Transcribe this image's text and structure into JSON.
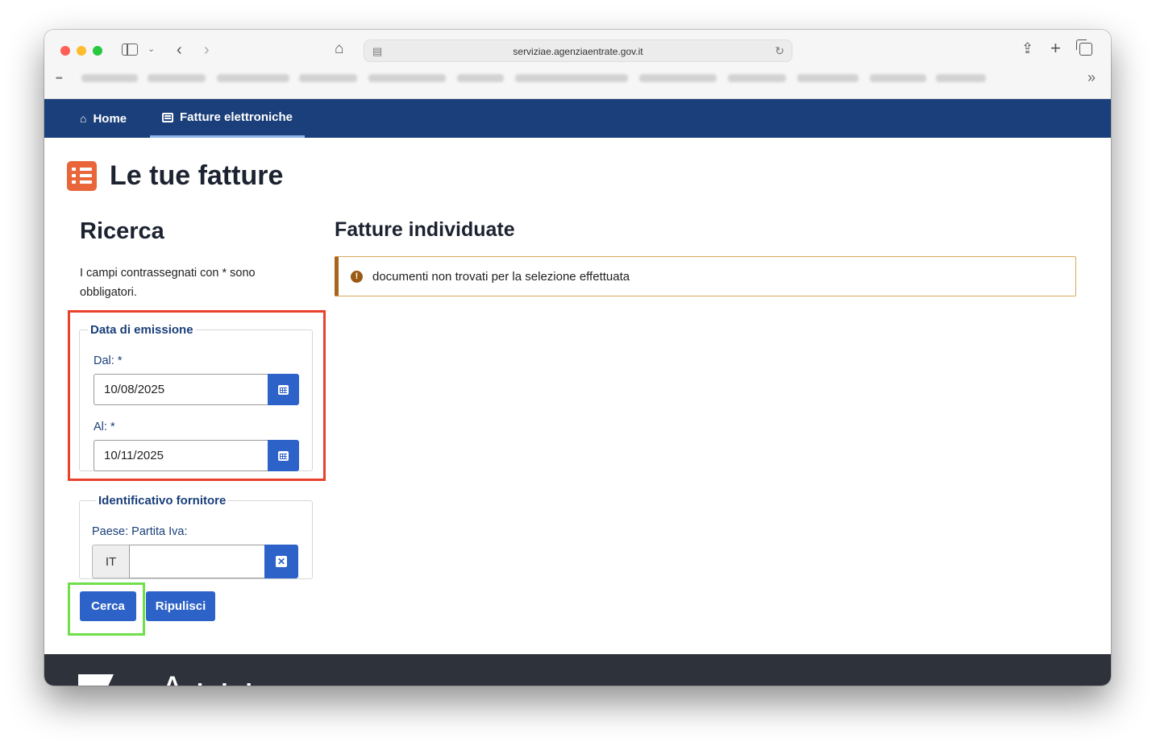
{
  "browser": {
    "url": "serviziae.agenziaentrate.gov.it"
  },
  "nav": {
    "home_label": "Home",
    "fatture_label": "Fatture elettroniche"
  },
  "page": {
    "title": "Le tue fatture"
  },
  "search": {
    "heading": "Ricerca",
    "required_note": "I campi contrassegnati con * sono obbligatori.",
    "date_group": {
      "legend": "Data di emissione",
      "from_label": "Dal: *",
      "from_value": "10/08/2025",
      "to_label": "Al: *",
      "to_value": "10/11/2025"
    },
    "supplier_group": {
      "legend": "Identificativo fornitore",
      "label": "Paese: Partita Iva:",
      "country": "IT",
      "vat_value": ""
    },
    "search_button": "Cerca",
    "reset_button": "Ripulisci"
  },
  "results": {
    "heading": "Fatture individuate",
    "message": "documenti non trovati per la selezione effettuata"
  },
  "colors": {
    "navbar": "#1a3f7a",
    "primary_button": "#2d62c8",
    "title_icon": "#e8663a",
    "alert_border": "#a8661c",
    "highlight_red": "#e8412c",
    "highlight_green": "#6fe04a"
  }
}
